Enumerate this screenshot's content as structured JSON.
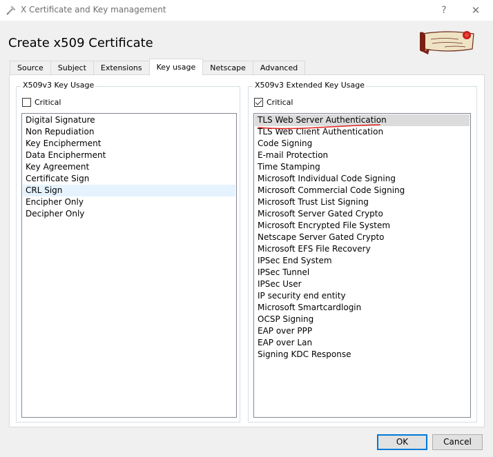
{
  "window": {
    "title": "X Certificate and Key management",
    "help_symbol": "?",
    "close_symbol": "✕"
  },
  "page_title": "Create x509 Certificate",
  "tabs": [
    {
      "label": "Source"
    },
    {
      "label": "Subject"
    },
    {
      "label": "Extensions"
    },
    {
      "label": "Key usage",
      "active": true
    },
    {
      "label": "Netscape"
    },
    {
      "label": "Advanced"
    }
  ],
  "key_usage": {
    "label": "X509v3 Key Usage",
    "critical_label": "Critical",
    "critical_checked": false,
    "items": [
      "Digital Signature",
      "Non Repudiation",
      "Key Encipherment",
      "Data Encipherment",
      "Key Agreement",
      "Certificate Sign",
      "CRL Sign",
      "Encipher Only",
      "Decipher Only"
    ],
    "highlighted_item": "CRL Sign"
  },
  "extended_key_usage": {
    "label": "X509v3 Extended Key Usage",
    "critical_label": "Critical",
    "critical_checked": true,
    "items": [
      "TLS Web Server Authentication",
      "TLS Web Client Authentication",
      "Code Signing",
      "E-mail Protection",
      "Time Stamping",
      "Microsoft Individual Code Signing",
      "Microsoft Commercial Code Signing",
      "Microsoft Trust List Signing",
      "Microsoft Server Gated Crypto",
      "Microsoft Encrypted File System",
      "Netscape Server Gated Crypto",
      "Microsoft EFS File Recovery",
      "IPSec End System",
      "IPSec Tunnel",
      "IPSec User",
      "IP security end entity",
      "Microsoft Smartcardlogin",
      "OCSP Signing",
      "EAP over PPP",
      "EAP over Lan",
      "Signing KDC Response"
    ],
    "selected_item": "TLS Web Server Authentication"
  },
  "buttons": {
    "ok": "OK",
    "cancel": "Cancel"
  },
  "colors": {
    "annotation_underline": "#e0201a",
    "selection": "#dcdcdc",
    "hover_highlight": "#e5f3ff",
    "default_button_border": "#0078d7"
  },
  "icons": {
    "app": "certificate-icon",
    "logo": "scroll-seal-logo"
  }
}
